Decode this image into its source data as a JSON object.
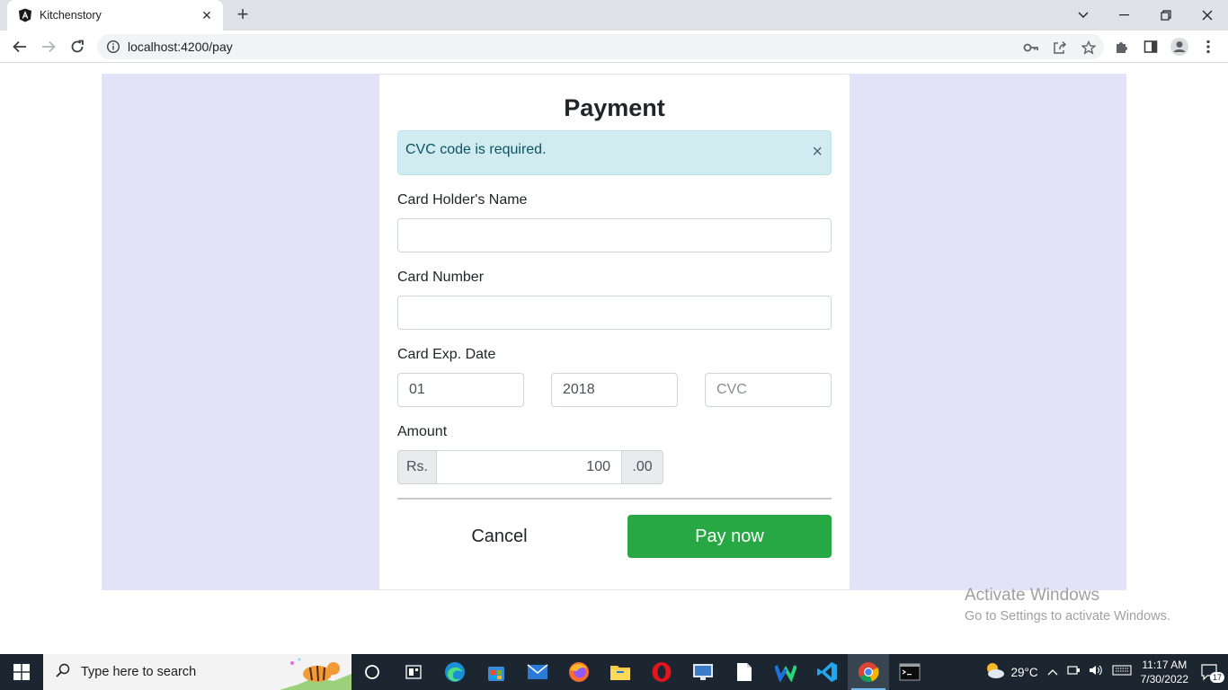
{
  "browser": {
    "tab_title": "Kitchenstory",
    "tab_close_symbol": "✕",
    "new_tab_symbol": "+",
    "url": "localhost:4200/pay",
    "icons": {
      "favicon": "angular-logo-icon",
      "back": "arrow-left-icon",
      "forward": "arrow-right-icon",
      "reload": "reload-icon",
      "info": "info-icon",
      "key": "key-icon",
      "share": "share-icon",
      "star": "star-icon",
      "extensions": "puzzle-icon",
      "side_panel": "side-panel-icon",
      "profile": "profile-icon",
      "menu": "kebab-menu-icon"
    }
  },
  "payment": {
    "title": "Payment",
    "alert": {
      "message": "CVC code is required.",
      "close_symbol": "×"
    },
    "card_holder": {
      "label": "Card Holder's Name",
      "value": ""
    },
    "card_number": {
      "label": "Card Number",
      "value": ""
    },
    "exp_date": {
      "label": "Card Exp. Date",
      "month": "01",
      "year": "2018",
      "cvc_placeholder": "CVC"
    },
    "amount": {
      "label": "Amount",
      "prefix": "Rs.",
      "value": "100",
      "suffix": ".00"
    },
    "cancel_label": "Cancel",
    "pay_label": "Pay now"
  },
  "watermark": {
    "line1": "Activate Windows",
    "line2": "Go to Settings to activate Windows."
  },
  "taskbar": {
    "search_placeholder": "Type here to search",
    "weather_temp": "29°C",
    "time": "11:17 AM",
    "date": "7/30/2022",
    "notification_count": "17"
  },
  "colors": {
    "page_background": "#e3e3f7",
    "alert_background": "#d1ecf1",
    "pay_button": "#28a745",
    "taskbar": "#1c2631"
  }
}
